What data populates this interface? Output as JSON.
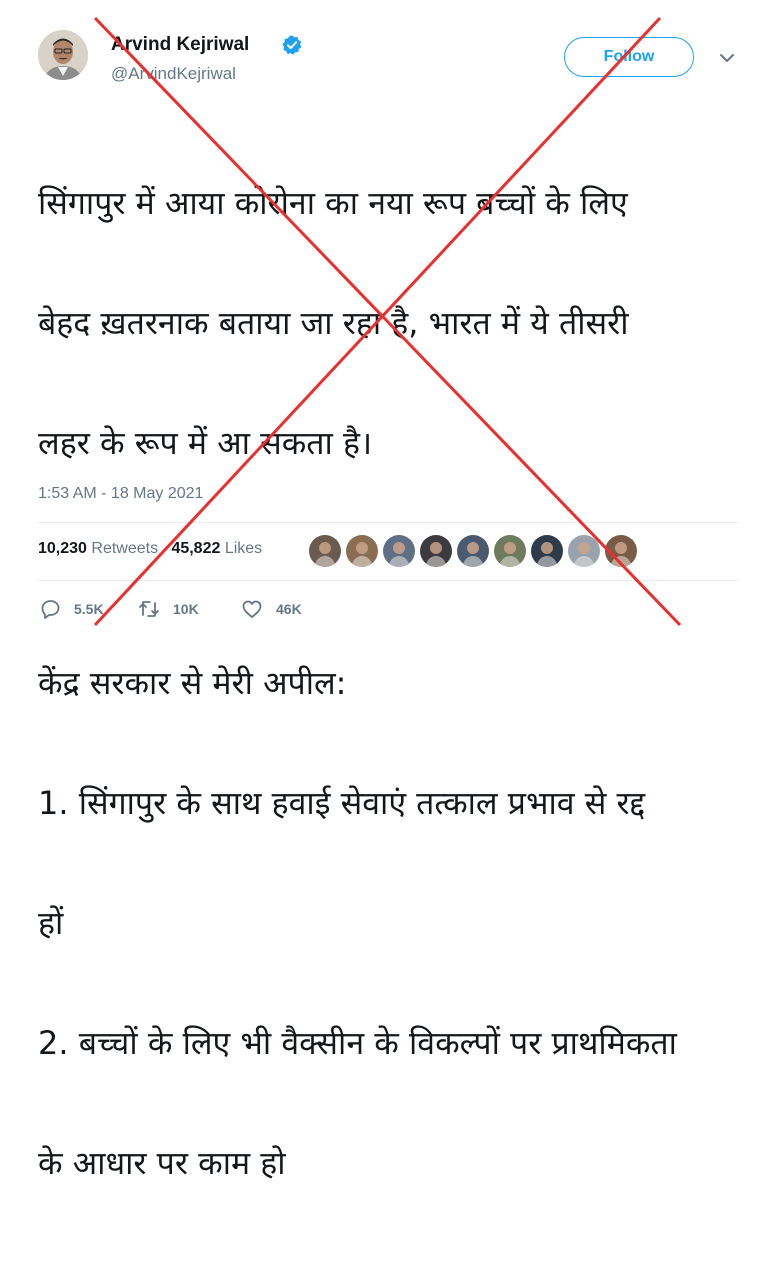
{
  "author": {
    "name": "Arvind Kejriwal",
    "handle": "@ArvindKejriwal",
    "verified": true,
    "avatar_icon": "profile-photo"
  },
  "follow_button": {
    "label": "Follow"
  },
  "menu": {
    "icon": "chevron-down-icon"
  },
  "tweet": {
    "lines": [
      "सिंगापुर में आया कोरोना का नया रूप बच्चों के लिए",
      "बेहद ख़तरनाक बताया जा रहा है, भारत में ये तीसरी",
      "लहर के रूप में आ सकता है।",
      "",
      "केंद्र सरकार से मेरी अपील:",
      "1. सिंगापुर के साथ हवाई सेवाएं तत्काल प्रभाव से रद्द",
      "हों",
      "2. बच्चों के लिए भी वैक्सीन के विकल्पों पर प्राथमिकता",
      "के आधार पर काम हो"
    ],
    "timestamp": "1:53 AM - 18 May 2021"
  },
  "stats": {
    "retweets_count": "10,230",
    "retweets_label": "Retweets",
    "likes_count": "45,822",
    "likes_label": "Likes"
  },
  "liker_avatars": [
    "#6b5a4e",
    "#8a6d52",
    "#5f6f86",
    "#3d3b40",
    "#4a5a70",
    "#6f7b5c",
    "#2f3a4a",
    "#9aa3ad",
    "#7a5b48"
  ],
  "actions": {
    "replies": "5.5K",
    "retweets": "10K",
    "likes": "46K"
  },
  "colors": {
    "brand": "#1da1f2",
    "text": "#14171a",
    "muted": "#657786",
    "cross": "#e8302f"
  }
}
